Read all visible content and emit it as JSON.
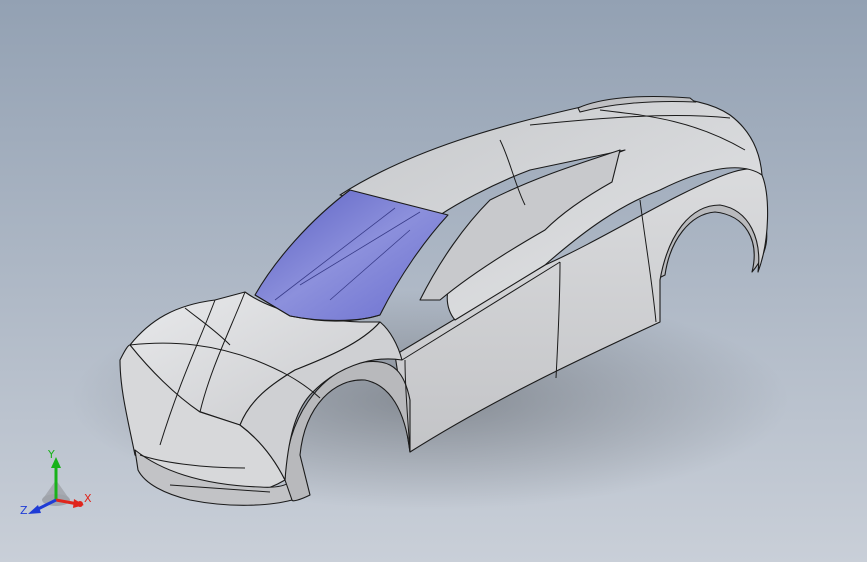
{
  "viewport": {
    "background_top": "#93a1b3",
    "background_bottom": "#c9cfd8"
  },
  "model": {
    "body_color": "#d3d4d6",
    "edge_color": "#1b1b1b",
    "glass_color": "#7b7fd0"
  },
  "triad": {
    "x_label": "X",
    "y_label": "Y",
    "z_label": "Z",
    "x_color": "#e0251c",
    "y_color": "#18b21a",
    "z_color": "#1f3cd6"
  }
}
